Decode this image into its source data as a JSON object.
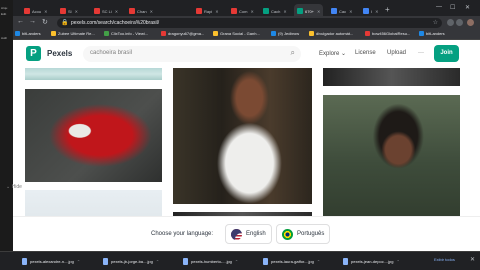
{
  "left_strip": [
    "Arqu",
    "Edit",
    "Auth"
  ],
  "tabs": [
    {
      "label": "Acou",
      "color": "#e53935"
    },
    {
      "label": "Sl",
      "color": "#e53935"
    },
    {
      "label": "SC Li",
      "color": "#e53935"
    },
    {
      "label": "Chan",
      "color": "#e53935"
    },
    {
      "label": "Rapi",
      "color": "#e53935"
    },
    {
      "label": "Com",
      "color": "#e53935"
    },
    {
      "label": "Cach",
      "color": "#05a081"
    },
    {
      "label": "670+",
      "color": "#05a081",
      "active": true
    },
    {
      "label": "Cac",
      "color": "#4285f4"
    },
    {
      "label": "I",
      "color": "#4285f4"
    }
  ],
  "address": {
    "url": "pexels.com/search/cachoeira%20brasil/"
  },
  "bookmarks": [
    {
      "label": "bitLanders",
      "color": "#1e88e5"
    },
    {
      "label": "Zubee Ultimate Re...",
      "color": "#fbc02d"
    },
    {
      "label": "ClixToo.info - Viewi...",
      "color": "#43a047"
    },
    {
      "label": "dragonyu67@gma...",
      "color": "#e53935"
    },
    {
      "label": "Grana Social - Ganh...",
      "color": "#fbc02d"
    },
    {
      "label": "(9) Jedbrow",
      "color": "#1e88e5"
    },
    {
      "label": "divulgador automát...",
      "color": "#fbc02d"
    },
    {
      "label": "bow456GlobalResu...",
      "color": "#e53935"
    },
    {
      "label": "bitLanders",
      "color": "#1e88e5"
    }
  ],
  "pexels": {
    "brand": "Pexels",
    "search_value": "cachoeira brasil",
    "nav": {
      "explore": "Explore",
      "license": "License",
      "upload": "Upload",
      "more": "···"
    },
    "join": "Join"
  },
  "language": {
    "label": "Choose your language:",
    "options": [
      {
        "label": "English",
        "flag": "us"
      },
      {
        "label": "Português",
        "flag": "br"
      }
    ]
  },
  "hide": "Hide",
  "downloads": [
    "pexels-alexandre-n....jpg",
    "pexels-jb-jorge-ba....jpg",
    "pexels-humberto-....jpg",
    "pexels-laura-gaffor....jpg",
    "pexels-jean-depoc....jpg"
  ],
  "show_all": "Exibir todos"
}
